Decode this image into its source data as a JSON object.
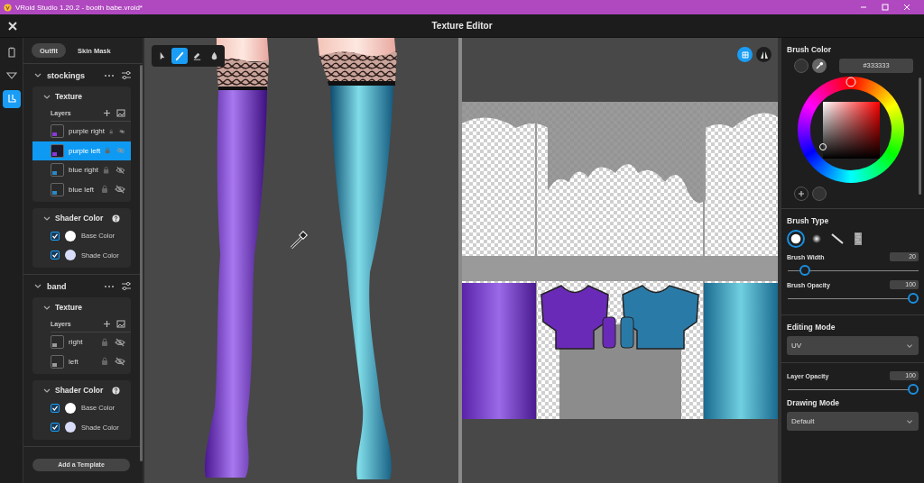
{
  "window": {
    "title": "VRoid Studio 1.20.2 - booth babe.vroid*"
  },
  "header": {
    "title": "Texture Editor"
  },
  "rail": [
    {
      "kind": "top",
      "selected": false
    },
    {
      "kind": "bottom",
      "selected": false
    },
    {
      "kind": "shoes",
      "selected": true
    }
  ],
  "mode_tabs": [
    {
      "label": "Outfit",
      "selected": true
    },
    {
      "label": "Skin Mask",
      "selected": false
    }
  ],
  "parts": [
    {
      "name": "stockings",
      "texture": {
        "title": "Texture",
        "layers_label": "Layers",
        "layers": [
          {
            "name": "purple right",
            "selected": false,
            "color": "#8a3ad8"
          },
          {
            "name": "purple left",
            "selected": true,
            "color": "#8a3ad8"
          },
          {
            "name": "blue right",
            "selected": false,
            "color": "#2a8ac8"
          },
          {
            "name": "blue left",
            "selected": false,
            "color": "#2a8ac8"
          }
        ]
      },
      "shader": {
        "title": "Shader Color",
        "colors": [
          {
            "label": "Base Color",
            "checked": true,
            "color": "#ffffff"
          },
          {
            "label": "Shade Color",
            "checked": true,
            "color": "#d8dcf8"
          }
        ]
      }
    },
    {
      "name": "band",
      "texture": {
        "title": "Texture",
        "layers_label": "Layers",
        "layers": [
          {
            "name": "right",
            "selected": false,
            "color": "#9a9a9a"
          },
          {
            "name": "left",
            "selected": false,
            "color": "#9a9a9a"
          }
        ]
      },
      "shader": {
        "title": "Shader Color",
        "colors": [
          {
            "label": "Base Color",
            "checked": true,
            "color": "#ffffff"
          },
          {
            "label": "Shade Color",
            "checked": true,
            "color": "#d8dcf8"
          }
        ]
      }
    }
  ],
  "add_template": "Add a Template",
  "viewport_tools": [
    {
      "kind": "select",
      "selected": false
    },
    {
      "kind": "brush",
      "selected": true
    },
    {
      "kind": "eraser",
      "selected": false
    },
    {
      "kind": "fill",
      "selected": false
    }
  ],
  "uv_toggles": [
    {
      "kind": "grid",
      "selected": true
    },
    {
      "kind": "mirror",
      "selected": false
    }
  ],
  "brush_color": {
    "title": "Brush Color",
    "hex": "#333333",
    "color": "#333333"
  },
  "brush_type": {
    "title": "Brush Type",
    "types": [
      {
        "kind": "round",
        "selected": true
      },
      {
        "kind": "soft",
        "selected": false
      },
      {
        "kind": "line",
        "selected": false
      },
      {
        "kind": "texture",
        "selected": false
      }
    ]
  },
  "brush_sliders": [
    {
      "label": "Brush Width",
      "value": "20",
      "level": 0.1
    },
    {
      "label": "Brush Opacity",
      "value": "100",
      "level": 1
    }
  ],
  "editing_mode": {
    "title": "Editing Mode",
    "value": "UV"
  },
  "layer_opacity": {
    "label": "Layer Opacity",
    "value": "100",
    "level": 1
  },
  "drawing_mode": {
    "title": "Drawing Mode",
    "value": "Default"
  }
}
